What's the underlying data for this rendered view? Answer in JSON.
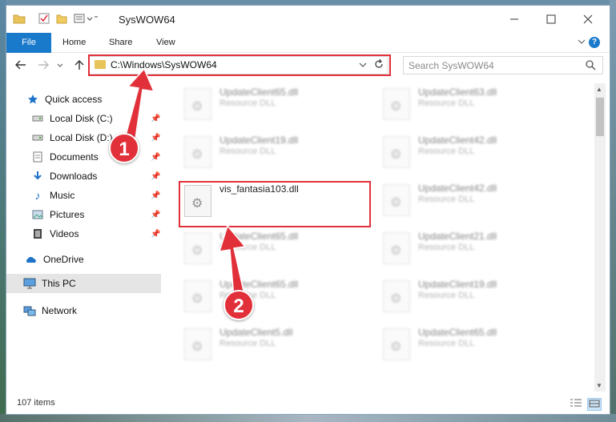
{
  "window": {
    "title": "SysWOW64"
  },
  "ribbon": {
    "tabs": [
      "File",
      "Home",
      "Share",
      "View"
    ]
  },
  "navigation": {
    "address": "C:\\Windows\\SysWOW64",
    "search_placeholder": "Search SysWOW64"
  },
  "sidebar": {
    "items": [
      {
        "label": "Quick access",
        "icon": "star-icon",
        "pinned": false
      },
      {
        "label": "Local Disk (C:)",
        "icon": "drive-icon",
        "pinned": true
      },
      {
        "label": "Local Disk (D:)",
        "icon": "drive-icon",
        "pinned": true
      },
      {
        "label": "Documents",
        "icon": "documents-icon",
        "pinned": true
      },
      {
        "label": "Downloads",
        "icon": "download-icon",
        "pinned": true
      },
      {
        "label": "Music",
        "icon": "music-icon",
        "pinned": true
      },
      {
        "label": "Pictures",
        "icon": "pictures-icon",
        "pinned": true
      },
      {
        "label": "Videos",
        "icon": "videos-icon",
        "pinned": true
      },
      {
        "label": "OneDrive",
        "icon": "cloud-icon",
        "pinned": false
      },
      {
        "label": "This PC",
        "icon": "computer-icon",
        "pinned": false,
        "selected": true
      },
      {
        "label": "Network",
        "icon": "network-icon",
        "pinned": false
      }
    ]
  },
  "files": {
    "left": [
      {
        "name": "UpdateClient65.dll",
        "type": "Resource DLL"
      },
      {
        "name": "UpdateClient19.dll",
        "type": "Resource DLL"
      },
      {
        "name": "vis_fantasia103.dll",
        "type": ""
      },
      {
        "name": "UpdateClient65.dll",
        "type": "Resource DLL"
      },
      {
        "name": "UpdateClient65.dll",
        "type": "Resource DLL"
      },
      {
        "name": "UpdateClient5.dll",
        "type": "Resource DLL"
      }
    ],
    "right": [
      {
        "name": "UpdateClient63.dll",
        "type": "Resource DLL"
      },
      {
        "name": "UpdateClient42.dll",
        "type": "Resource DLL"
      },
      {
        "name": "UpdateClient42.dll",
        "type": "Resource DLL"
      },
      {
        "name": "UpdateClient21.dll",
        "type": "Resource DLL"
      },
      {
        "name": "UpdateClient19.dll",
        "type": "Resource DLL"
      },
      {
        "name": "UpdateClient65.dll",
        "type": "Resource DLL"
      }
    ]
  },
  "status": {
    "item_count": "107 items"
  },
  "annotations": {
    "step1": "1",
    "step2": "2",
    "color": "#e2303a"
  }
}
